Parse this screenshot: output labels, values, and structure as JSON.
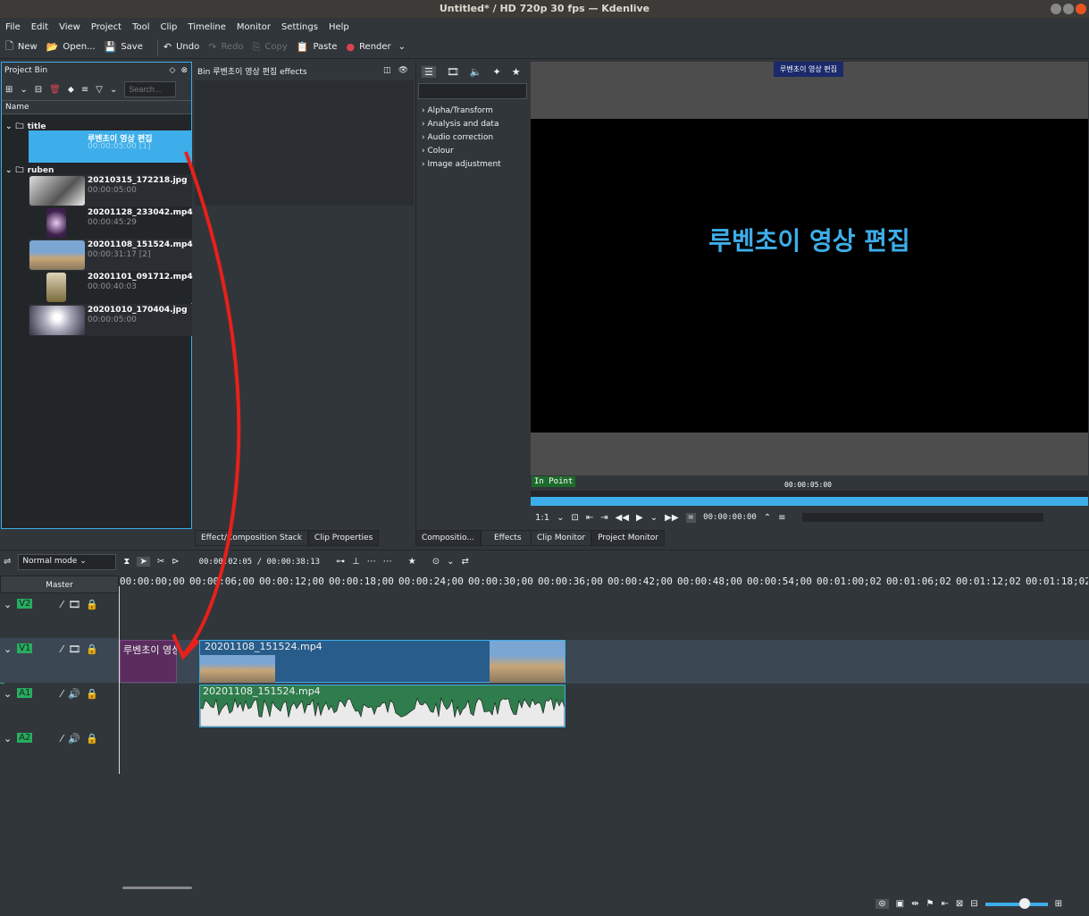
{
  "window": {
    "title": "Untitled* / HD 720p 30 fps — Kdenlive"
  },
  "menu": [
    "File",
    "Edit",
    "View",
    "Project",
    "Tool",
    "Clip",
    "Timeline",
    "Monitor",
    "Settings",
    "Help"
  ],
  "toolbar": {
    "new": "New",
    "open": "Open...",
    "save": "Save",
    "undo": "Undo",
    "redo": "Redo",
    "copy": "Copy",
    "paste": "Paste",
    "render": "Render"
  },
  "bin": {
    "title": "Project Bin",
    "search_placeholder": "Search...",
    "column": "Name",
    "folders": [
      {
        "name": "title",
        "clips": [
          {
            "name": "루벤초이 영상 편집",
            "duration": "00:00:05:00 [1]"
          }
        ]
      },
      {
        "name": "ruben",
        "clips": [
          {
            "name": "20210315_172218.jpg",
            "duration": "00:00:05:00"
          },
          {
            "name": "20201128_233042.mp4",
            "duration": "00:00:45:29"
          },
          {
            "name": "20201108_151524.mp4",
            "duration": "00:00:31:17 [2]"
          },
          {
            "name": "20201101_091712.mp4",
            "duration": "00:00:40:03"
          },
          {
            "name": "20201010_170404.jpg",
            "duration": "00:00:05:00"
          }
        ]
      }
    ]
  },
  "effects_panel": {
    "title": "Bin 루벤초이 영상 편집 effects",
    "tab1": "Effect/Composition Stack",
    "tab2": "Clip Properties"
  },
  "effects_list": {
    "categories": [
      "Alpha/Transform",
      "Analysis and data",
      "Audio correction",
      "Colour",
      "Image adjustment"
    ],
    "tab1": "Compositio...",
    "tab2": "Effects"
  },
  "monitor": {
    "overlay_title": "루벤초이 영상 편집",
    "screen_title": "루벤초이 영상 편집",
    "in_point": "In Point",
    "duration": "00:00:05:00",
    "zoom": "1:1",
    "timecode": "00:00:00:00",
    "tab1": "Clip Monitor",
    "tab2": "Project Monitor"
  },
  "timeline": {
    "mode": "Normal mode",
    "position": "00:00:02:05 / 00:00:38:13",
    "master": "Master",
    "ruler": [
      "00:00:00;00",
      "00:00:06;00",
      "00:00:12;00",
      "00:00:18;00",
      "00:00:24;00",
      "00:00:30;00",
      "00:00:36;00",
      "00:00:42;00",
      "00:00:48;00",
      "00:00:54;00",
      "00:01:00;02",
      "00:01:06;02",
      "00:01:12;02",
      "00:01:18;02"
    ],
    "tracks": [
      "V2",
      "V1",
      "A1",
      "A2"
    ],
    "clips": {
      "title_clip": "루벤초이 영상 편집",
      "video_clip": "20201108_151524.mp4",
      "audio_clip": "20201108_151524.mp4"
    }
  },
  "colors": {
    "accent": "#3daee9",
    "arrow": "#e8201a",
    "track_label": "#27ae60",
    "audio_clip": "#2f7d4c"
  }
}
